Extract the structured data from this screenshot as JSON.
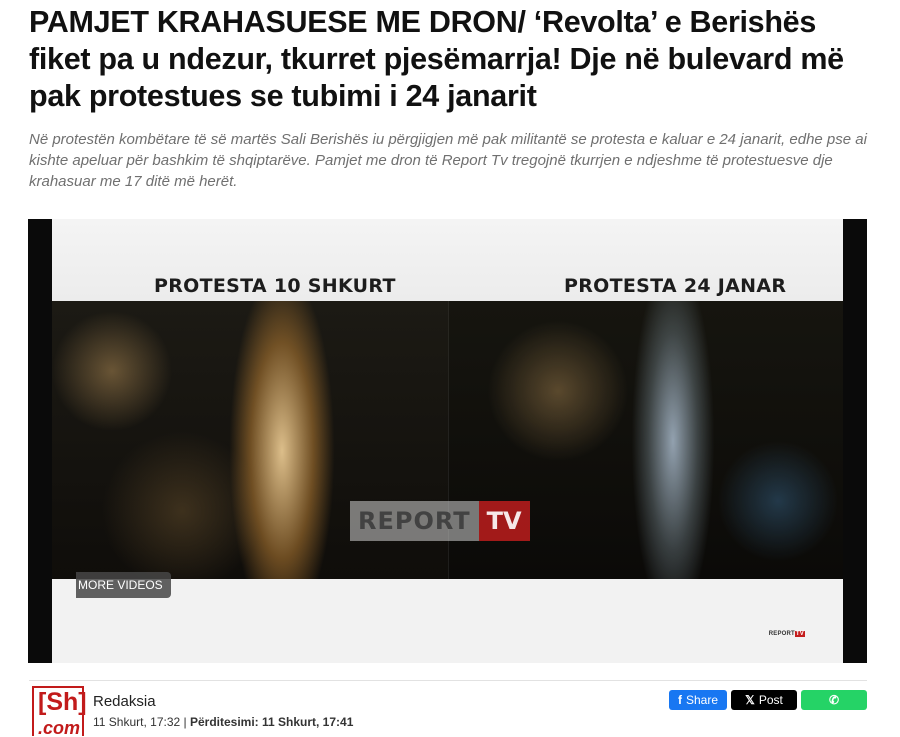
{
  "article": {
    "headline": "PAMJET KRAHASUESE ME DRON/ ‘Revolta’ e Berishës fiket pa u ndezur, tkurret pjesëmarrja! Dje në bulevard më pak protestues se tubimi i 24 janarit",
    "lead": "Në protestën kombëtare të së martës Sali Berishës iu përgjigjen më pak militantë se protesta e kaluar e 24 janarit, edhe pse ai kishte apeluar për bashkim të shqiptarëve. Pamjet me dron të Report Tv tregojnë tkurrjen e ndjeshme të protestuesve dje krahasuar me 17 ditë më herët."
  },
  "video": {
    "caption_left": "PROTESTA 10 SHKURT",
    "caption_right": "PROTESTA 24 JANAR",
    "watermark_report": "REPORT",
    "watermark_tv": "TV",
    "more_videos": "MORE VIDEOS",
    "corner_logo_report": "REPORT",
    "corner_logo_tv": "TV"
  },
  "byline": {
    "logo_top": "[Sh]",
    "logo_bottom": ".com",
    "author": "Redaksia",
    "published": "11 Shkurt, 17:32",
    "separator": " | ",
    "updated_label": "Përditesimi: 11 Shkurt, 17:41"
  },
  "share": {
    "facebook_icon": "f",
    "facebook_label": "Share",
    "x_icon": "𝕏",
    "x_label": "Post",
    "whatsapp_icon": "✆"
  },
  "colors": {
    "brand_red": "#c21b1b",
    "facebook": "#1877f2",
    "x": "#000000",
    "whatsapp": "#25d366"
  }
}
